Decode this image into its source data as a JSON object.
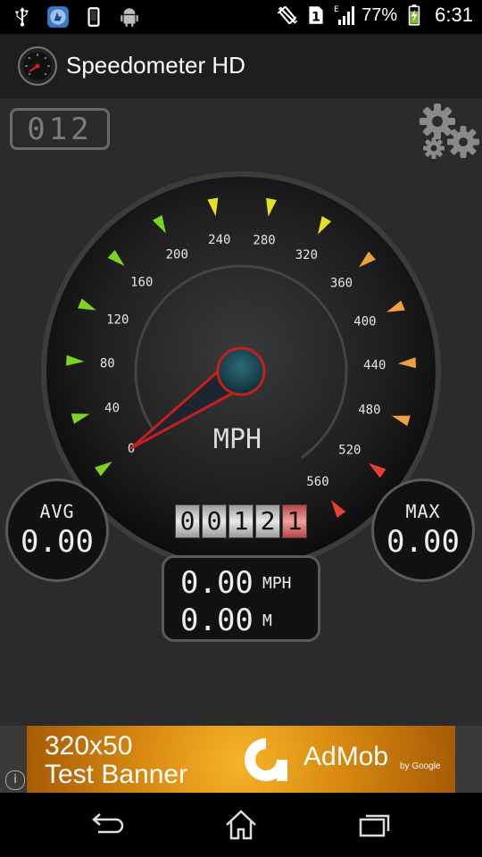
{
  "status_bar": {
    "battery_percent": "77%",
    "time": "6:31",
    "network_type": "E",
    "sim_slot": "1",
    "icons": [
      "usb-icon",
      "app-notification-icon",
      "phone-icon",
      "android-icon",
      "vibrate-icon",
      "sim-icon",
      "signal-icon",
      "battery-charging-icon"
    ]
  },
  "app_bar": {
    "title": "Speedometer HD",
    "logo_icon": "speedometer-logo-icon"
  },
  "trip_counter": "012",
  "gauge": {
    "unit_label": "MPH",
    "tick_labels": [
      "0",
      "40",
      "80",
      "120",
      "160",
      "200",
      "240",
      "280",
      "320",
      "360",
      "400",
      "440",
      "480",
      "520",
      "560"
    ],
    "needle_value": 0,
    "scale_max": 560
  },
  "odometer": [
    "0",
    "0",
    "1",
    "2",
    "1"
  ],
  "avg": {
    "label": "AVG",
    "value": "0.00"
  },
  "max": {
    "label": "MAX",
    "value": "0.00"
  },
  "readout": {
    "speed_value": "0.00",
    "speed_unit": "MPH",
    "distance_value": "0.00",
    "distance_unit": "M"
  },
  "ad_banner": {
    "line1": "320x50",
    "line2": "Test Banner",
    "brand": "AdMob",
    "by_line": "by Google",
    "info_icon": "i"
  },
  "nav_bar": {
    "buttons": [
      "back-icon",
      "home-icon",
      "recent-apps-icon"
    ]
  },
  "colors": {
    "background": "#2b2b2b",
    "tick_green": "#7ed321",
    "tick_yellow": "#e8e020",
    "tick_orange": "#f0a040",
    "tick_red": "#e84030",
    "needle_red": "#c81e1e"
  }
}
